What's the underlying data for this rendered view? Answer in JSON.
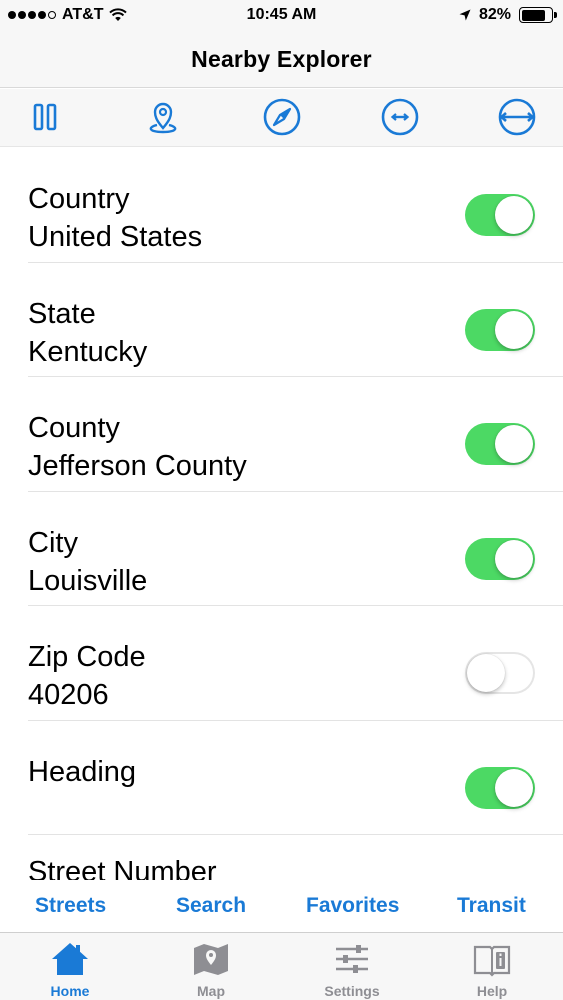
{
  "status_bar": {
    "carrier": "AT&T",
    "time": "10:45 AM",
    "battery": "82%",
    "battery_level": 0.82
  },
  "nav": {
    "title": "Nearby Explorer"
  },
  "toolbar": {
    "icons": [
      "pause-icon",
      "location-pin-icon",
      "compass-icon",
      "range-narrow-icon",
      "range-wide-icon"
    ]
  },
  "rows": [
    {
      "label": "Country",
      "value": "United States",
      "on": true
    },
    {
      "label": "State",
      "value": "Kentucky",
      "on": true
    },
    {
      "label": "County",
      "value": "Jefferson County",
      "on": true
    },
    {
      "label": "City",
      "value": "Louisville",
      "on": true
    },
    {
      "label": "Zip Code",
      "value": "40206",
      "on": false
    },
    {
      "label": "Heading",
      "value": "",
      "on": true
    },
    {
      "label": "Street Number",
      "value": ""
    }
  ],
  "segments": [
    "Streets",
    "Search",
    "Favorites",
    "Transit"
  ],
  "tabs": [
    {
      "label": "Home",
      "icon": "home-icon",
      "active": true
    },
    {
      "label": "Map",
      "icon": "map-icon",
      "active": false
    },
    {
      "label": "Settings",
      "icon": "settings-sliders-icon",
      "active": false
    },
    {
      "label": "Help",
      "icon": "book-info-icon",
      "active": false
    }
  ],
  "colors": {
    "accent": "#1a7ad6",
    "toggle_on": "#4cd964",
    "tab_inactive": "#8e8e93"
  }
}
